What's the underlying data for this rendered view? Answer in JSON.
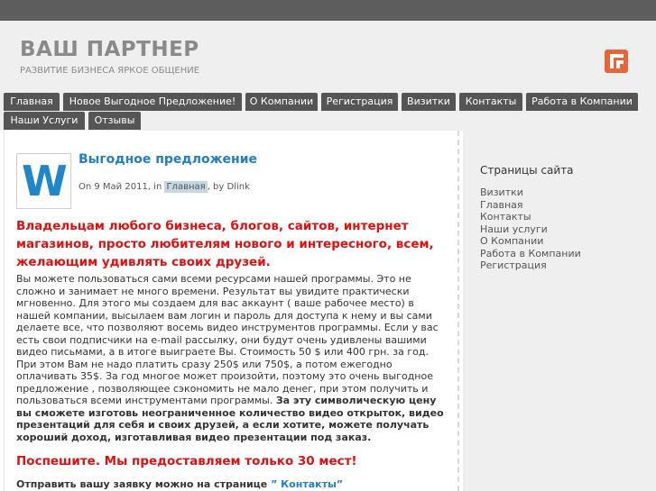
{
  "header": {
    "site_title": "ВАШ ПАРТНЕР",
    "site_description": "РАЗВИТИЕ БИЗНЕСА ЯРКОЕ ОБЩЕНИЕ",
    "rss_icon": "rss-icon",
    "rss_color": "#e6663a"
  },
  "nav": {
    "items": [
      "Главная",
      "Новое Выгодное Предложение!",
      "О Компании",
      "Регистрация",
      "Визитки",
      "Контакты",
      "Работа в Компании",
      "Наши Услуги",
      "Отзывы"
    ]
  },
  "post": {
    "thumb_letter": "W",
    "title": "Выгодное предложение",
    "meta_prefix": "On 9 Май 2011, in",
    "meta_category": "Главная",
    "meta_suffix": ", by Dlink",
    "lead": "Владельцам любого бизнеса, блогов, сайтов, интернет магазинов, просто любителям нового и интересного, всем, желающим удивлять своих друзей.",
    "body": "Вы можете пользоваться сами всеми ресурсами нашей программы.  Это не сложно и занимает не много времени.  Результат вы увидите практически мгновенно. Для этого мы создаем для вас аккаунт ( ваше рабочее место) в нашей компании, высылаем вам логин и пароль для доступа к нему и вы сами делаете все, что позволяют восемь видео инструментов программы.  Если у вас есть свои подписчики на e-mail рассылку,  они будут очень удивлены вашими видео письмами, а в итоге выиграете Вы.   Стоимость  50 $ или 400 грн. за год. При этом Вам не надо платить сразу 250$ или 750$, а потом ежегодно оплачивать 35$. За год многое может произойти, поэтому это очень выгодное предложение , позволяющее сэкономить не мало денег, при этом получить и пользоваться всеми инструментами программы. ",
    "body_bold": " За эту символическую цену вы сможете изготовь неограниченное количество видео открыток, видео презентаций для себя и своих друзей, а если хотите, можете получать хороший доход, изготавливая видео презентации под заказ.",
    "hurry": "Поспешите. Мы предоставляем только 30  мест!",
    "apply_text": "Отправить вашу заявку можно на странице ",
    "apply_link": "” Контакты”"
  },
  "sidebar": {
    "title": "Страницы сайта",
    "items": [
      "Визитки",
      "Главная",
      "Контакты",
      "Наши услуги",
      "О Компании",
      "Работа в Компании",
      "Регистрация"
    ]
  }
}
